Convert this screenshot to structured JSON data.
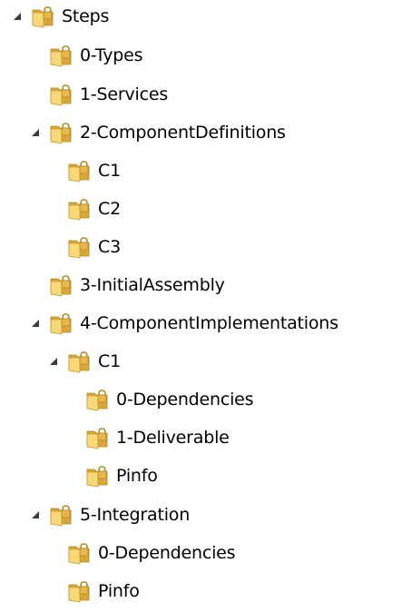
{
  "tree": {
    "nodes": [
      {
        "label": "Steps",
        "level": 0,
        "expanded": true
      },
      {
        "label": "0-Types",
        "level": 1
      },
      {
        "label": "1-Services",
        "level": 1
      },
      {
        "label": "2-ComponentDefinitions",
        "level": 1,
        "expanded": true
      },
      {
        "label": "C1",
        "level": 2
      },
      {
        "label": "C2",
        "level": 2
      },
      {
        "label": "C3",
        "level": 2
      },
      {
        "label": "3-InitialAssembly",
        "level": 1
      },
      {
        "label": "4-ComponentImplementations",
        "level": 1,
        "expanded": true
      },
      {
        "label": "C1",
        "level": 2,
        "expanded": true
      },
      {
        "label": "0-Dependencies",
        "level": 3
      },
      {
        "label": "1-Deliverable",
        "level": 3
      },
      {
        "label": "Pinfo",
        "level": 3
      },
      {
        "label": "5-Integration",
        "level": 1,
        "expanded": true
      },
      {
        "label": "0-Dependencies",
        "level": 2
      },
      {
        "label": "Pinfo",
        "level": 2
      }
    ]
  },
  "icons": {
    "folder": "locked-folder-icon",
    "expander": "expanded-triangle-icon"
  },
  "colors": {
    "folder_light": "#f7d87a",
    "folder_dark": "#d9a739",
    "lock": "#b08a22",
    "expander": "#3b3b3b"
  }
}
